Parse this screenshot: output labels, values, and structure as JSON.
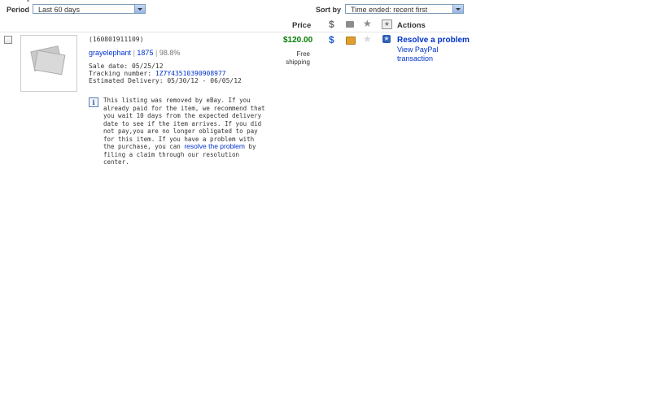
{
  "filters": {
    "period_label": "Period",
    "period_value": "Last 60 days",
    "sortby_label": "Sort by",
    "sortby_value": "Time ended: recent first"
  },
  "columns": {
    "price": "Price",
    "actions": "Actions"
  },
  "item": {
    "item_number": "(160801911109)",
    "seller": "grayelephant",
    "feedback_score": "1875",
    "positive_pct": "98.8%",
    "price": "$120.00",
    "shipping": "Free shipping",
    "sale_date": "Sale date: 05/25/12",
    "tracking_label": "Tracking number:",
    "tracking_number": "1Z7Y43510390908977",
    "est_delivery": "Estimated Delivery: 05/30/12 - 06/05/12"
  },
  "actions": {
    "resolve": "Resolve a problem",
    "view_paypal_line1": "View PayPal",
    "view_paypal_line2": "transaction"
  },
  "notice": {
    "text_before": "This listing was removed by eBay. If you already paid for the item, we recommend that you wait 10 days from the expected delivery date to see if the item arrives. If you did not pay,you are no longer obligated to pay for this item. If you have a problem with the purchase, you can",
    "link": "resolve the problem",
    "text_after": "by filing a claim through our resolution center."
  },
  "colors": {
    "price_green": "#008000",
    "link_blue": "#0033cc",
    "dollar_blue": "#1f5fc9"
  }
}
